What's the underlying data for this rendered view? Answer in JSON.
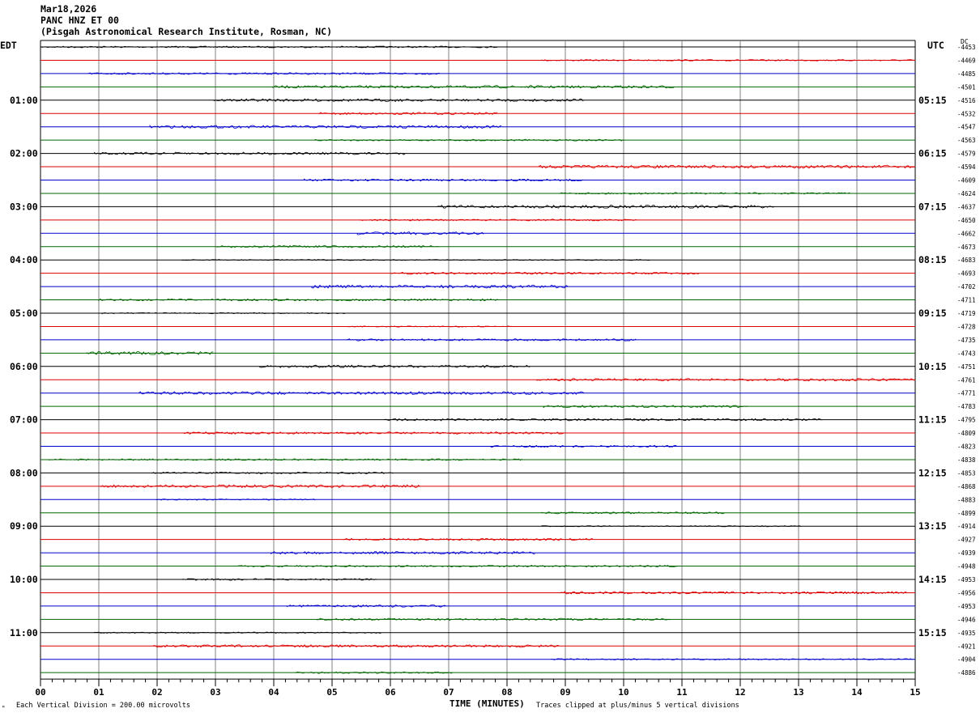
{
  "header": {
    "date": "Mar18,2026",
    "station": "PANC HNZ ET 00",
    "site": "(Pisgah Astronomical Research Institute, Rosman, NC)"
  },
  "left_axis": {
    "label": "EDT"
  },
  "right_axis": {
    "label": "UTC",
    "dc_label": "DC"
  },
  "footer": {
    "corner_mark": "ᴹ",
    "vertical_division": "Each Vertical Division =  200.00 microvolts",
    "clip_note": "Traces clipped at plus/minus 5 vertical divisions"
  },
  "colors": {
    "trace_cycle": [
      "#000000",
      "#dd0000",
      "#0000cc",
      "#006600"
    ],
    "grid": "#808080"
  },
  "chart_data": {
    "type": "line",
    "title": "Mar18,2026 PANC HNZ ET 00",
    "xlabel": "TIME (MINUTES)",
    "xlim": [
      0,
      15
    ],
    "x_ticks": [
      "00",
      "01",
      "02",
      "03",
      "04",
      "05",
      "06",
      "07",
      "08",
      "09",
      "10",
      "11",
      "12",
      "13",
      "14",
      "15"
    ],
    "rows_per_hour": 4,
    "left_hour_labels": [
      "01:00",
      "02:00",
      "03:00",
      "04:00",
      "05:00",
      "06:00",
      "07:00",
      "08:00",
      "09:00",
      "10:00",
      "11:00"
    ],
    "right_hour_labels": [
      "05:15",
      "06:15",
      "07:15",
      "08:15",
      "09:15",
      "10:15",
      "11:15",
      "12:15",
      "13:15",
      "14:15",
      "15:15"
    ],
    "dc_offsets": [
      "-4453",
      "-4469",
      "-4485",
      "-4501",
      "-4516",
      "-4532",
      "-4547",
      "-4563",
      "-4579",
      "-4594",
      "-4609",
      "-4624",
      "-4637",
      "-4650",
      "-4662",
      "-4673",
      "-4683",
      "-4693",
      "-4702",
      "-4711",
      "-4719",
      "-4728",
      "-4735",
      "-4743",
      "-4751",
      "-4761",
      "-4771",
      "-4783",
      "-4795",
      "-4809",
      "-4823",
      "-4838",
      "-4853",
      "-4868",
      "-4883",
      "-4899",
      "-4914",
      "-4927",
      "-4939",
      "-4948",
      "-4953",
      "-4956",
      "-4953",
      "-4946",
      "-4935",
      "-4921",
      "-4904",
      "-4886"
    ],
    "vertical_division_microvolts": 200,
    "clip_divisions": 5
  }
}
